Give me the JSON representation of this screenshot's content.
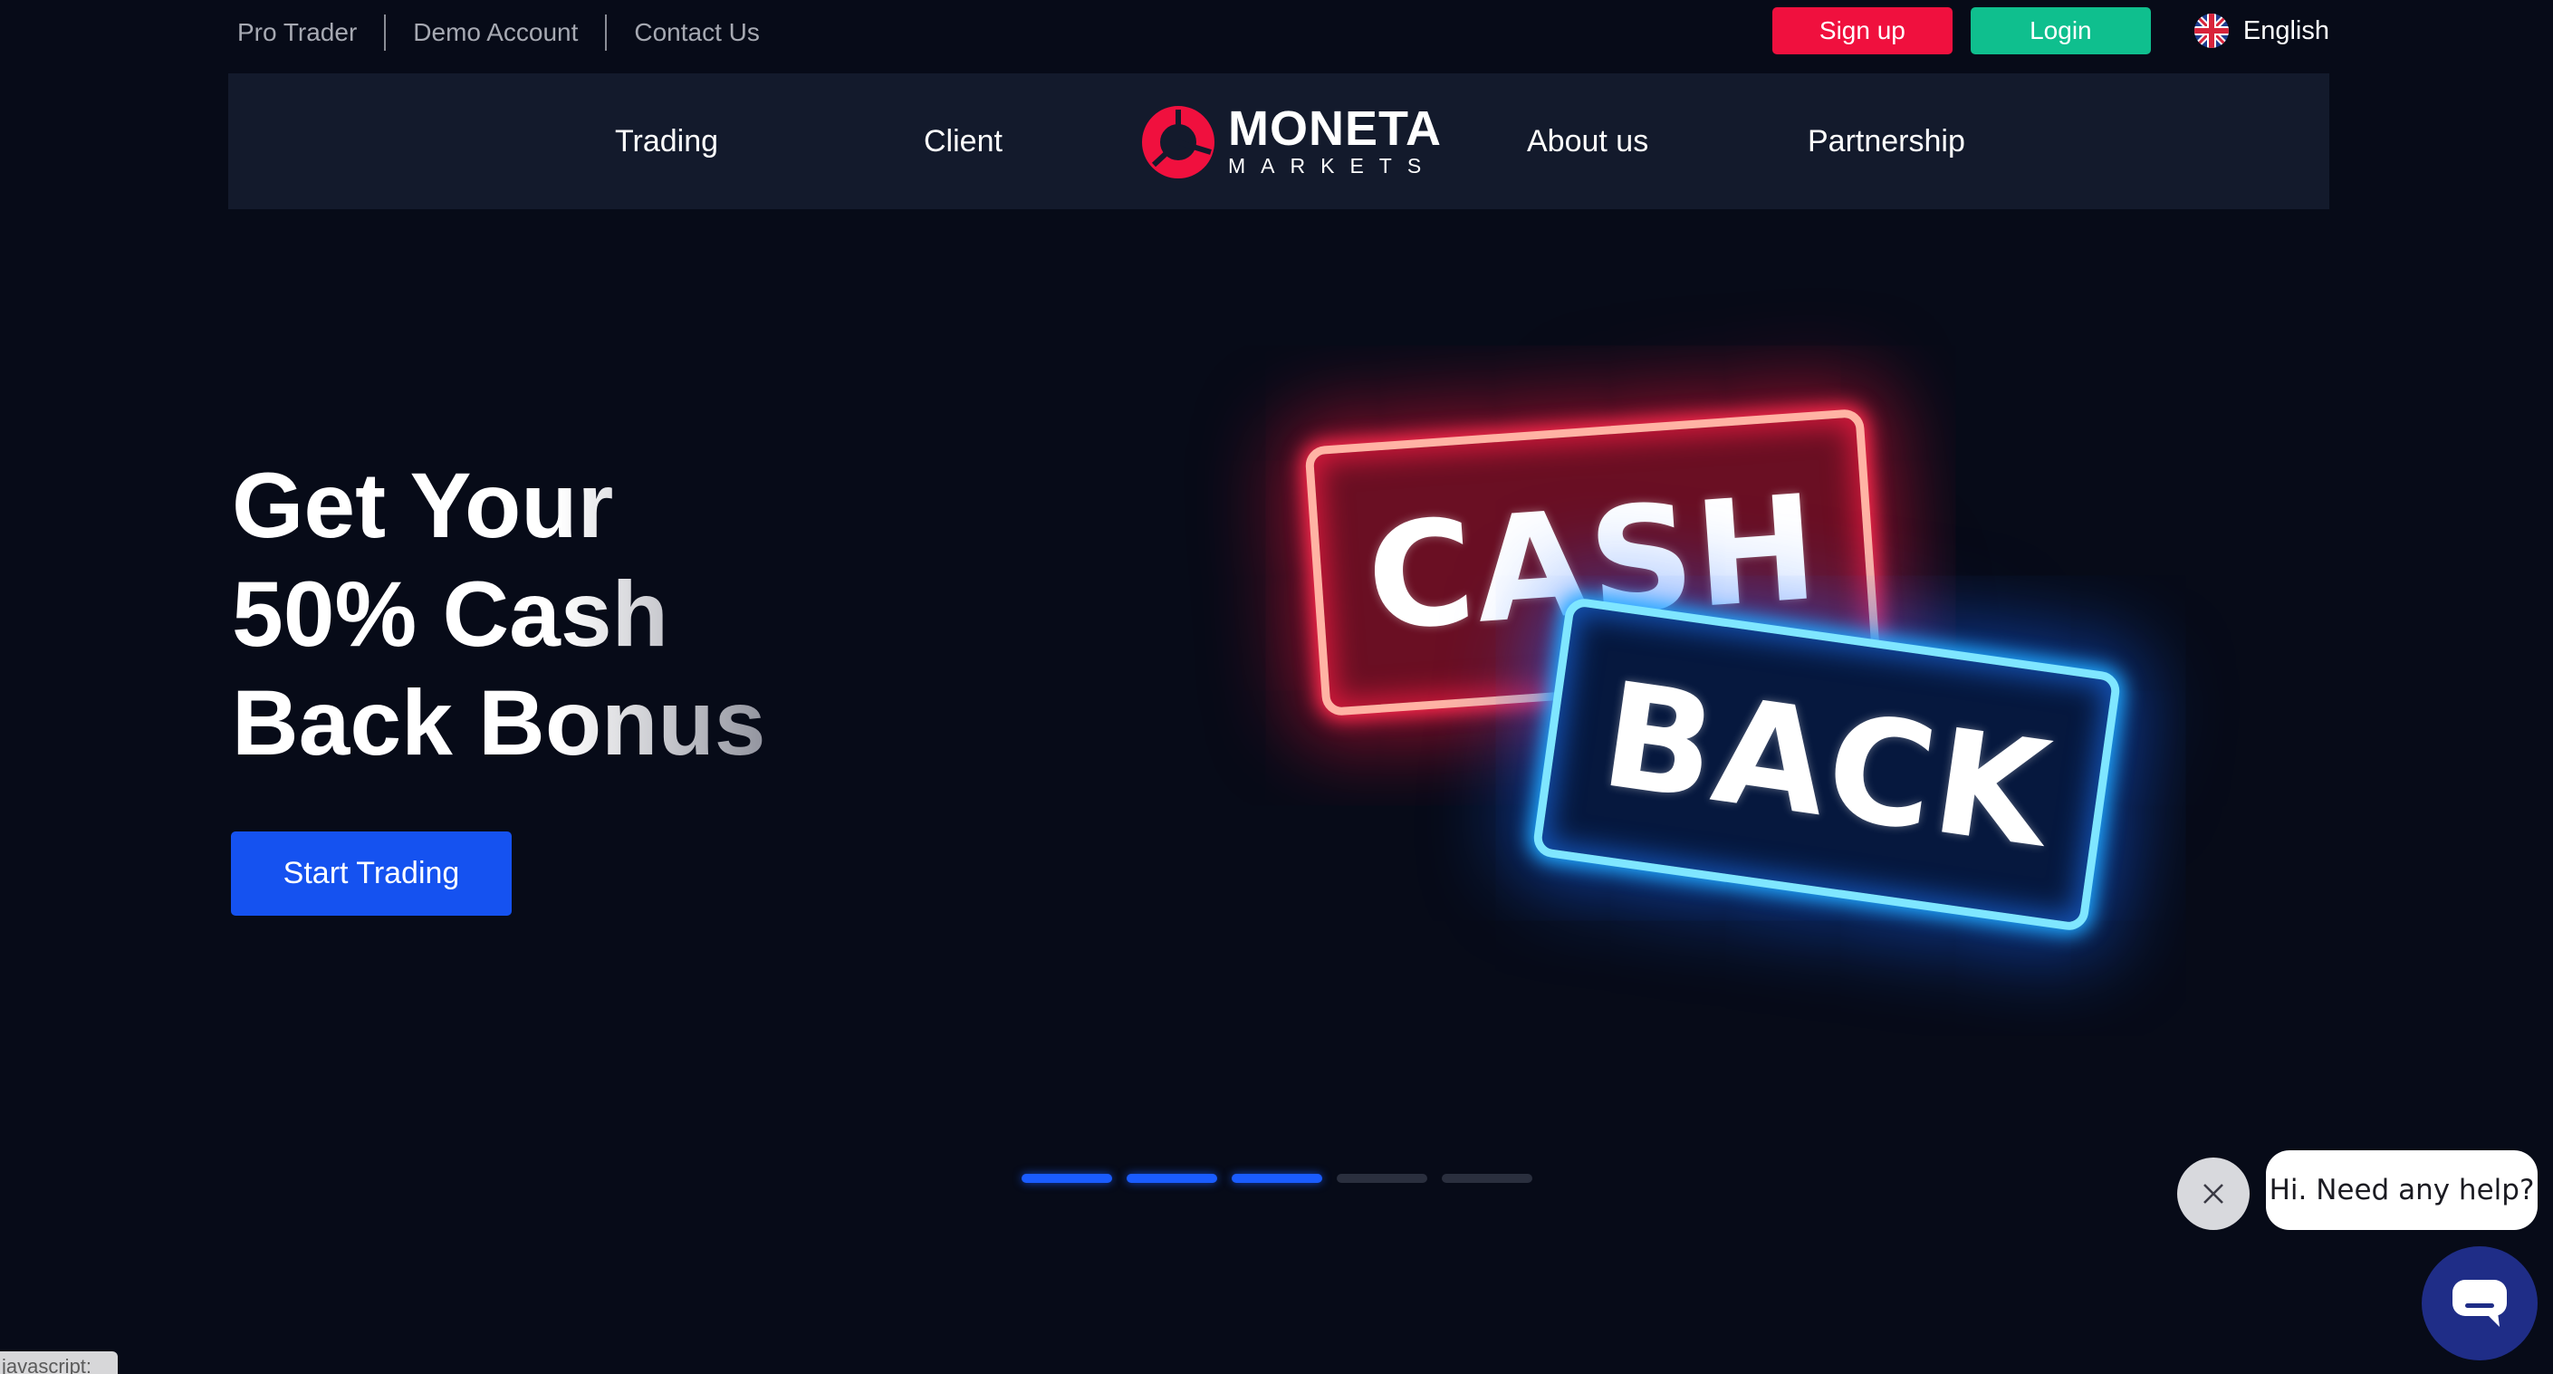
{
  "topbar": {
    "links": [
      "Pro Trader",
      "Demo Account",
      "Contact Us"
    ],
    "signup_label": "Sign up",
    "login_label": "Login",
    "language": "English",
    "signup_color": "#f0103e",
    "login_color": "#0fbf8e"
  },
  "nav": {
    "trading": "Trading",
    "client": "Client",
    "about": "About us",
    "partnership": "Partnership",
    "logo_title": "MONETA",
    "logo_sub": "MARKETS"
  },
  "hero": {
    "title_line1": "Get Your",
    "title_line2": "50% Cash",
    "title_line3": "Back Bonus",
    "cta_label": "Start Trading",
    "cta_color": "#1552f0",
    "sign_top": "CASH",
    "sign_bottom": "BACK"
  },
  "carousel": {
    "total_slides": 5,
    "active_indicators": 3
  },
  "help_widget": {
    "message": "Hi. Need any help?"
  },
  "status_bar": {
    "text": "javascript:"
  }
}
